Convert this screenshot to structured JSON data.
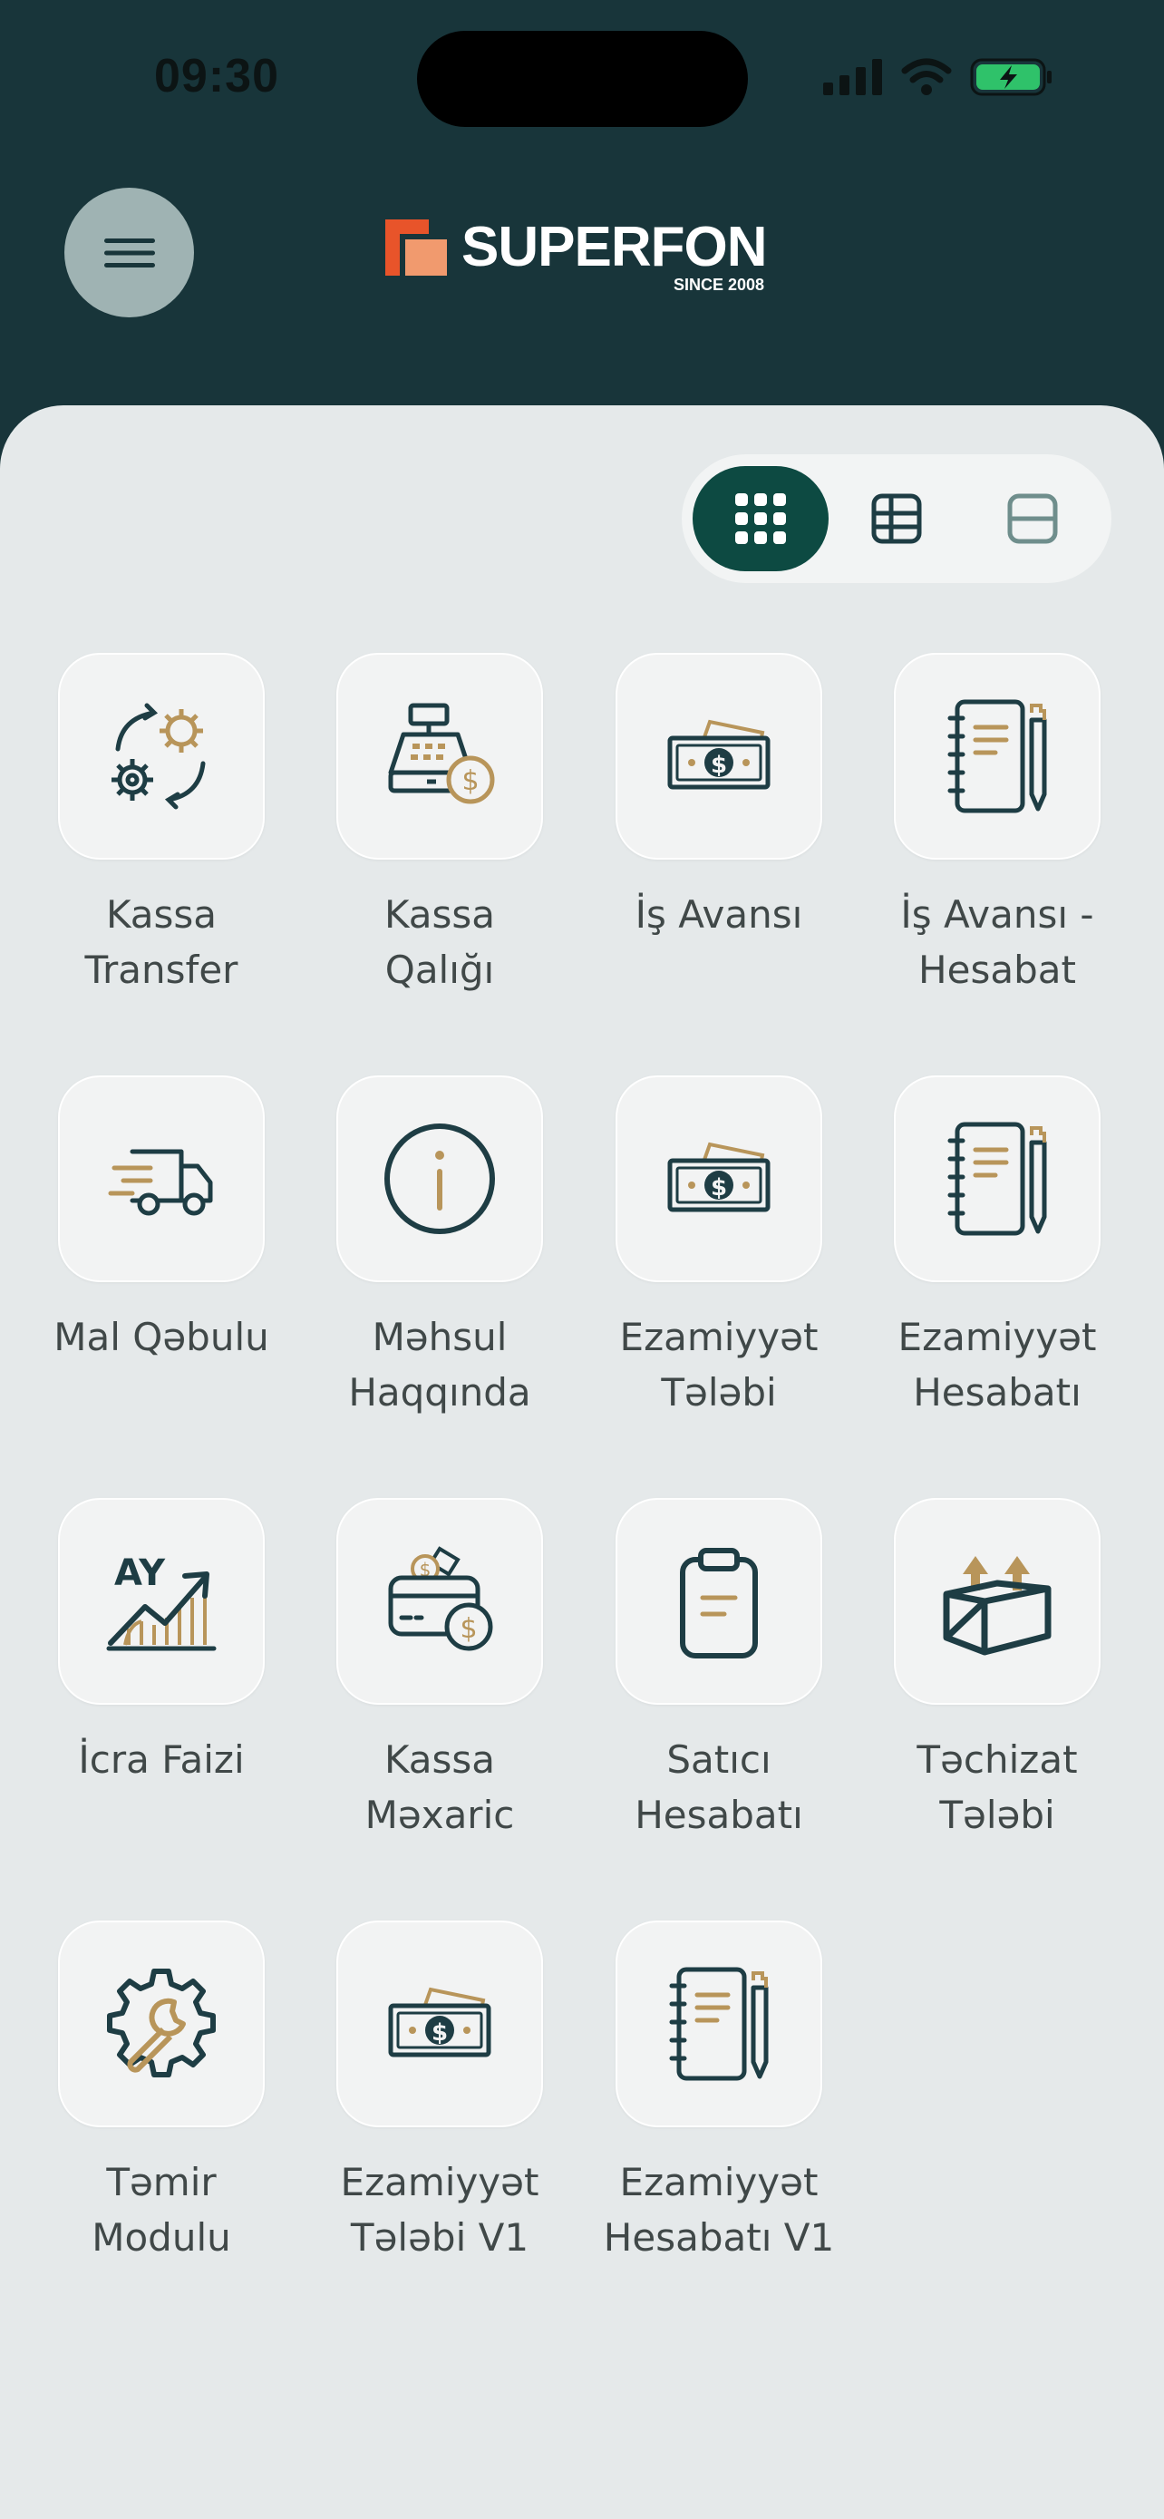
{
  "status_bar": {
    "time": "09:30"
  },
  "header": {
    "logo": {
      "name": "SUPERFON",
      "tagline": "SINCE 2008"
    },
    "menu_icon": "hamburger-icon"
  },
  "view_toggle": {
    "options": [
      "grid-large-icon",
      "grid-small-icon",
      "list-icon"
    ],
    "selected": 0
  },
  "colors": {
    "header_bg": "#18353a",
    "content_bg": "#e5e9ea",
    "accent": "#0d4a42",
    "icon_dark": "#1e3d44",
    "icon_gold": "#b8955a",
    "logo_orange": "#e8542a"
  },
  "tiles": [
    {
      "line1": "Kassa",
      "line2": "Transfer",
      "icon": "transfer-gears-icon"
    },
    {
      "line1": "Kassa",
      "line2": "Qalığı",
      "icon": "cash-register-icon"
    },
    {
      "line1": "İş Avansı",
      "line2": "",
      "icon": "banknote-icon"
    },
    {
      "line1": "İş Avansı -",
      "line2": "Hesabat",
      "icon": "notebook-pen-icon"
    },
    {
      "line1": "Mal Qəbulu",
      "line2": "",
      "icon": "delivery-truck-icon"
    },
    {
      "line1": "Məhsul",
      "line2": "Haqqında",
      "icon": "info-icon"
    },
    {
      "line1": "Ezamiyyət",
      "line2": "Tələbi",
      "icon": "banknote-icon"
    },
    {
      "line1": "Ezamiyyət",
      "line2": "Hesabatı",
      "icon": "notebook-pen-icon"
    },
    {
      "line1": "İcra Faizi",
      "line2": "",
      "icon": "growth-chart-icon"
    },
    {
      "line1": "Kassa",
      "line2": "Məxaric",
      "icon": "wallet-coins-icon"
    },
    {
      "line1": "Satıcı",
      "line2": "Hesabatı",
      "icon": "clipboard-icon"
    },
    {
      "line1": "Təchizat",
      "line2": "Tələbi",
      "icon": "box-upload-icon"
    },
    {
      "line1": "Təmir",
      "line2": "Modulu",
      "icon": "gear-wrench-icon"
    },
    {
      "line1": "Ezamiyyət",
      "line2": "Tələbi V1",
      "icon": "banknote-icon"
    },
    {
      "line1": "Ezamiyyət",
      "line2": "Hesabatı V1",
      "icon": "notebook-pen-icon"
    }
  ]
}
